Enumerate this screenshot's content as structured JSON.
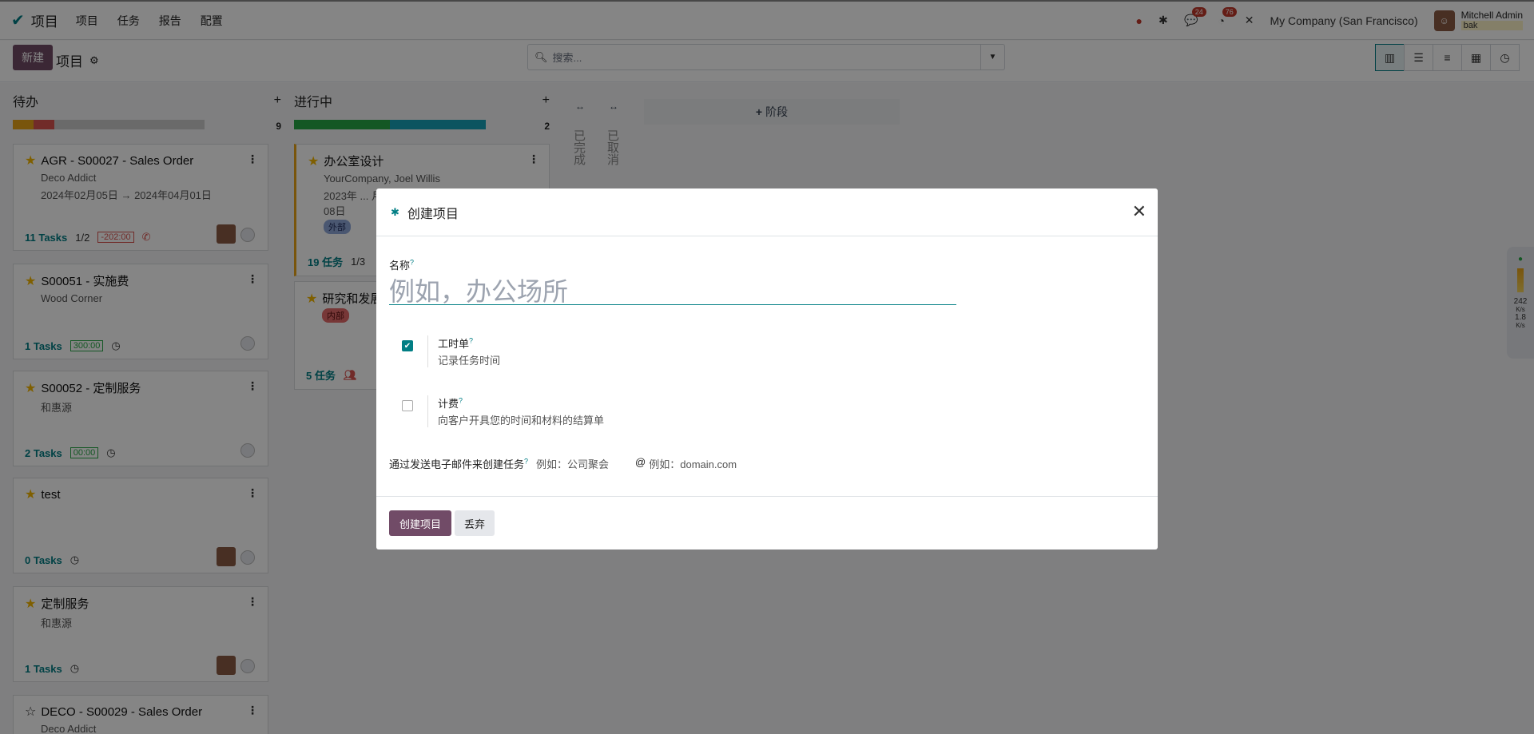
{
  "topbar": {
    "app_name": "项目",
    "menu": [
      "项目",
      "任务",
      "报告",
      "配置"
    ],
    "chat_count": "24",
    "activity_count": "76",
    "company": "My Company (San Francisco)",
    "user_name": "Mitchell Admin",
    "db_name": "bak"
  },
  "control": {
    "new_label": "新建",
    "title": "项目",
    "search_placeholder": "搜索..."
  },
  "columns": [
    {
      "name": "待办",
      "count": "9"
    },
    {
      "name": "进行中",
      "count": "2"
    }
  ],
  "folded": [
    "已完成",
    "已取消"
  ],
  "add_stage": "阶段",
  "cards_col1": [
    {
      "title": "AGR - S00027 - Sales Order",
      "partner": "Deco Addict",
      "dates": "2024年02月05日 → 2024年04月01日",
      "tasks": "11 Tasks",
      "milestone": "1/2",
      "tag": "-202:00",
      "starred": true
    },
    {
      "title": "S00051 - 实施费",
      "partner": "Wood Corner",
      "tasks": "1 Tasks",
      "tag": "300:00",
      "starred": true
    },
    {
      "title": "S00052 - 定制服务",
      "partner": "和惠源",
      "tasks": "2 Tasks",
      "tag": "00:00",
      "starred": true
    },
    {
      "title": "test",
      "partner": "",
      "tasks": "0 Tasks",
      "starred": true
    },
    {
      "title": "定制服务",
      "partner": "和惠源",
      "tasks": "1 Tasks",
      "starred": true
    },
    {
      "title": "DECO - S00029 - Sales Order",
      "partner": "Deco Addict",
      "starred": false
    }
  ],
  "cards_col2": [
    {
      "title": "办公室设计",
      "partner": "YourCompany, Joel Willis",
      "dates": "2023年 ... 月08日",
      "badge": "外部",
      "tasks": "19 任务",
      "milestone": "1/3"
    },
    {
      "title": "研究和发展",
      "badge": "内部",
      "tasks": "5 任务"
    }
  ],
  "meter": {
    "top": "242",
    "top_unit": "K/s",
    "bottom": "1.8",
    "bottom_unit": "K/s"
  },
  "modal": {
    "title": "创建项目",
    "name_label": "名称",
    "name_placeholder": "例如，办公场所",
    "timesheet_label": "工时单",
    "timesheet_desc": "记录任务时间",
    "billing_label": "计费",
    "billing_desc": "向客户开具您的时间和材料的结算单",
    "email_label": "通过发送电子邮件来创建任务",
    "alias_placeholder": "例如：公司聚会",
    "domain_placeholder": "例如：domain.com",
    "create_label": "创建项目",
    "discard_label": "丢弃"
  },
  "colors": {
    "brand": "#714B67",
    "accent": "#017e84"
  }
}
